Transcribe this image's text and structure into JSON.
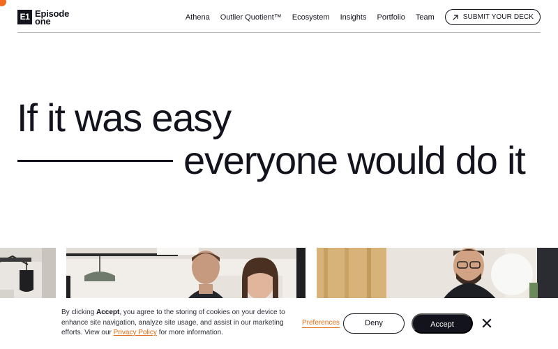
{
  "header": {
    "logo": {
      "mark": "E1",
      "text": "Episode one"
    },
    "nav": [
      {
        "label": "Athena"
      },
      {
        "label": "Outlier Quotient™"
      },
      {
        "label": "Ecosystem"
      },
      {
        "label": "Insights"
      },
      {
        "label": "Portfolio"
      },
      {
        "label": "Team"
      }
    ],
    "cta": {
      "label": "SUBMIT YOUR DECK",
      "icon": "arrow-up-right-icon"
    }
  },
  "hero": {
    "line1": "If it was easy",
    "line2": "everyone would do it"
  },
  "cookie_banner": {
    "text_prefix": "By clicking ",
    "text_bold": "Accept",
    "text_middle": ", you agree to the storing of cookies on your device to enhance site navigation, analyze site usage, and assist in our marketing efforts. View our ",
    "privacy_link": "Privacy Policy",
    "text_suffix": " for more information.",
    "preferences_label": "Preferences",
    "deny_label": "Deny",
    "accept_label": "Accept",
    "close_icon": "close-icon"
  },
  "colors": {
    "text": "#12131c",
    "accent": "#e36a12",
    "cursor_dot": "#f26a1b",
    "divider": "#b9b9bd"
  }
}
